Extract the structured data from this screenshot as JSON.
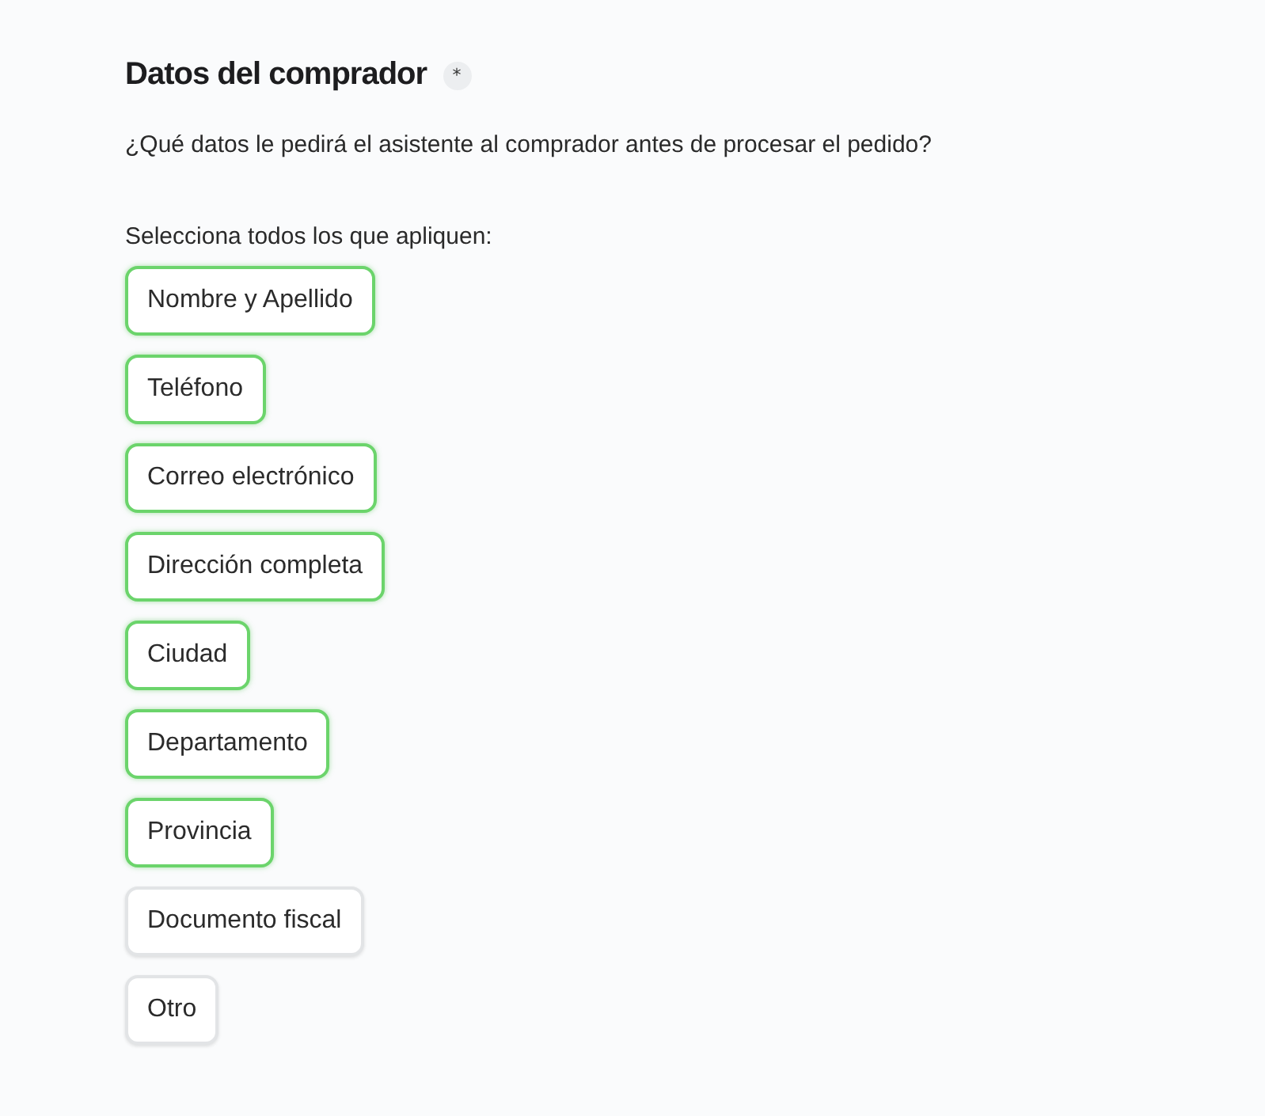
{
  "title": "Datos del comprador",
  "required_mark": "*",
  "question": "¿Qué datos le pedirá el asistente al comprador antes de procesar el pedido?",
  "instruction": "Selecciona todos los que apliquen:",
  "options": [
    {
      "label": "Nombre y Apellido",
      "selected": true
    },
    {
      "label": "Teléfono",
      "selected": true
    },
    {
      "label": "Correo electrónico",
      "selected": true
    },
    {
      "label": "Dirección completa",
      "selected": true
    },
    {
      "label": "Ciudad",
      "selected": true
    },
    {
      "label": "Departamento",
      "selected": true
    },
    {
      "label": "Provincia",
      "selected": true
    },
    {
      "label": "Documento fiscal",
      "selected": false
    },
    {
      "label": "Otro",
      "selected": false
    }
  ]
}
